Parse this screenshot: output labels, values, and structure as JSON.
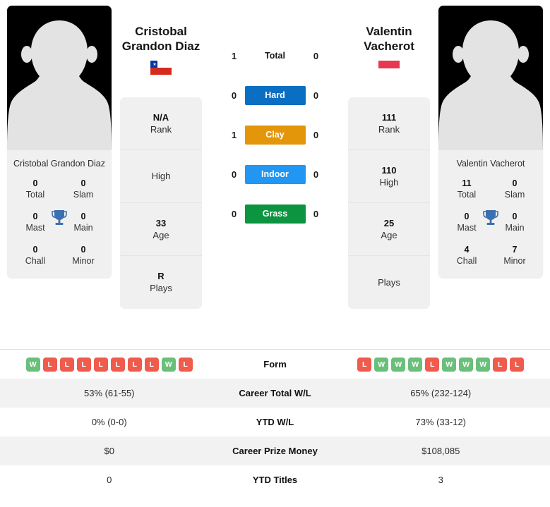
{
  "players": {
    "left": {
      "name": "Cristobal Grandon Diaz",
      "name_line1": "Cristobal",
      "name_line2": "Grandon Diaz",
      "card_name": "Cristobal Grandon Diaz",
      "flag": "chile-flag",
      "titles": {
        "total_value": "0",
        "total_label": "Total",
        "slam_value": "0",
        "slam_label": "Slam",
        "mast_value": "0",
        "mast_label": "Mast",
        "main_value": "0",
        "main_label": "Main",
        "chall_value": "0",
        "chall_label": "Chall",
        "minor_value": "0",
        "minor_label": "Minor"
      },
      "attributes": [
        {
          "value": "N/A",
          "label": "Rank"
        },
        {
          "value": "",
          "label": "High"
        },
        {
          "value": "33",
          "label": "Age"
        },
        {
          "value": "R",
          "label": "Plays"
        }
      ],
      "form": [
        "W",
        "L",
        "L",
        "L",
        "L",
        "L",
        "L",
        "L",
        "W",
        "L"
      ]
    },
    "right": {
      "name": "Valentin Vacherot",
      "name_line1": "Valentin",
      "name_line2": "Vacherot",
      "card_name": "Valentin Vacherot",
      "flag": "monaco-flag",
      "titles": {
        "total_value": "11",
        "total_label": "Total",
        "slam_value": "0",
        "slam_label": "Slam",
        "mast_value": "0",
        "mast_label": "Mast",
        "main_value": "0",
        "main_label": "Main",
        "chall_value": "4",
        "chall_label": "Chall",
        "minor_value": "7",
        "minor_label": "Minor"
      },
      "attributes": [
        {
          "value": "111",
          "label": "Rank"
        },
        {
          "value": "110",
          "label": "High"
        },
        {
          "value": "25",
          "label": "Age"
        },
        {
          "value": "",
          "label": "Plays"
        }
      ],
      "form": [
        "L",
        "W",
        "W",
        "W",
        "L",
        "W",
        "W",
        "W",
        "L",
        "L"
      ]
    }
  },
  "head_to_head": [
    {
      "label": "Total",
      "left": "1",
      "right": "0",
      "color": "",
      "plain": true
    },
    {
      "label": "Hard",
      "left": "0",
      "right": "0",
      "color": "#0a6fc2",
      "plain": false
    },
    {
      "label": "Clay",
      "left": "1",
      "right": "0",
      "color": "#e3960a",
      "plain": false
    },
    {
      "label": "Indoor",
      "left": "0",
      "right": "0",
      "color": "#2196f3",
      "plain": false
    },
    {
      "label": "Grass",
      "left": "0",
      "right": "0",
      "color": "#0d9440",
      "plain": false
    }
  ],
  "stats_table": [
    {
      "label": "Form",
      "left": "",
      "right": "",
      "is_form": true,
      "alt": false
    },
    {
      "label": "Career Total W/L",
      "left": "53% (61-55)",
      "right": "65% (232-124)",
      "is_form": false,
      "alt": true
    },
    {
      "label": "YTD W/L",
      "left": "0% (0-0)",
      "right": "73% (33-12)",
      "is_form": false,
      "alt": false
    },
    {
      "label": "Career Prize Money",
      "left": "$0",
      "right": "$108,085",
      "is_form": false,
      "alt": true
    },
    {
      "label": "YTD Titles",
      "left": "0",
      "right": "3",
      "is_form": false,
      "alt": false
    }
  ],
  "colors": {
    "hard": "#0a6fc2",
    "clay": "#e3960a",
    "indoor": "#2196f3",
    "grass": "#0d9440",
    "win": "#6abf7a",
    "loss": "#ef5b4c",
    "trophy": "#3a6fb0",
    "card_bg": "#f0f0f0"
  }
}
